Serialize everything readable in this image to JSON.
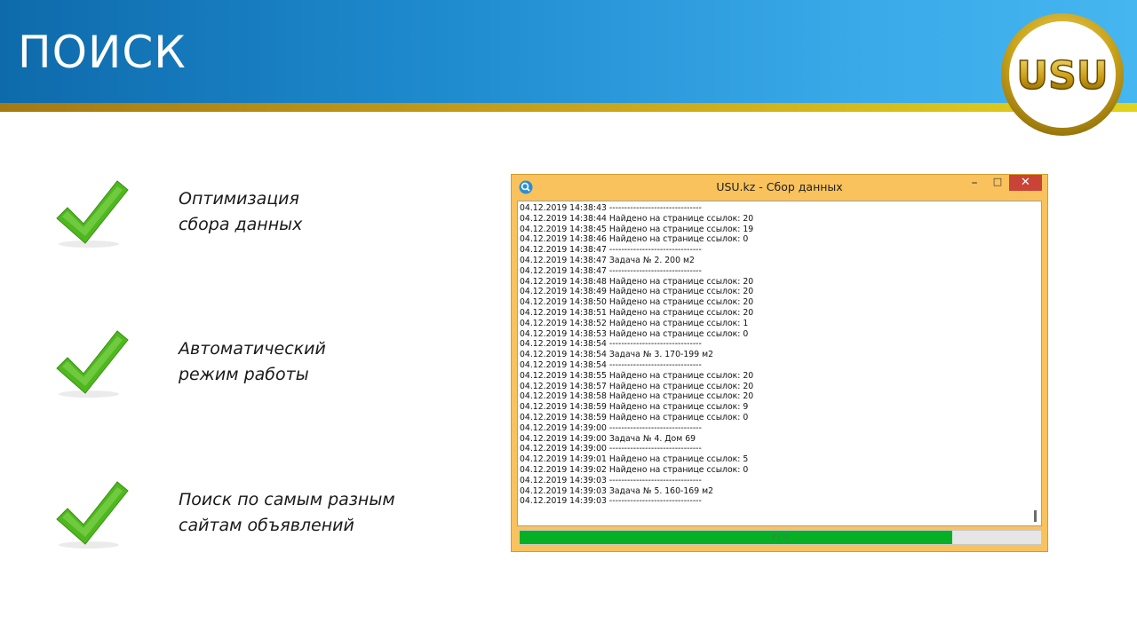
{
  "slide": {
    "title": "ПОИСК",
    "colors": {
      "header_start": "#0e6aab",
      "header_end": "#45b6f0",
      "gold": "#c9a21a",
      "check_green": "#4fb81f"
    }
  },
  "logo": {
    "text": "USU",
    "icon": "usu-logo"
  },
  "bullets": [
    {
      "line1": "Оптимизация",
      "line2": "сбора данных",
      "icon": "checkmark-icon"
    },
    {
      "line1": "Автоматический",
      "line2": "режим работы",
      "icon": "checkmark-icon"
    },
    {
      "line1": "Поиск по самым разным",
      "line2": "сайтам объявлений",
      "icon": "checkmark-icon"
    }
  ],
  "window": {
    "title": "USU.kz - Сбор данных",
    "icon": "search-app-icon",
    "controls": {
      "minimize": "–",
      "maximize": "□",
      "close": "✕"
    },
    "log_lines": [
      "04.12.2019 14:38:43 -------------------------------",
      "04.12.2019 14:38:44 Найдено на странице ссылок: 20",
      "04.12.2019 14:38:45 Найдено на странице ссылок: 19",
      "04.12.2019 14:38:46 Найдено на странице ссылок: 0",
      "04.12.2019 14:38:47 -------------------------------",
      "04.12.2019 14:38:47 Задача № 2. 200 м2",
      "04.12.2019 14:38:47 -------------------------------",
      "04.12.2019 14:38:48 Найдено на странице ссылок: 20",
      "04.12.2019 14:38:49 Найдено на странице ссылок: 20",
      "04.12.2019 14:38:50 Найдено на странице ссылок: 20",
      "04.12.2019 14:38:51 Найдено на странице ссылок: 20",
      "04.12.2019 14:38:52 Найдено на странице ссылок: 1",
      "04.12.2019 14:38:53 Найдено на странице ссылок: 0",
      "04.12.2019 14:38:54 -------------------------------",
      "04.12.2019 14:38:54 Задача № 3. 170-199 м2",
      "04.12.2019 14:38:54 -------------------------------",
      "04.12.2019 14:38:55 Найдено на странице ссылок: 20",
      "04.12.2019 14:38:57 Найдено на странице ссылок: 20",
      "04.12.2019 14:38:58 Найдено на странице ссылок: 20",
      "04.12.2019 14:38:59 Найдено на странице ссылок: 9",
      "04.12.2019 14:38:59 Найдено на странице ссылок: 0",
      "04.12.2019 14:39:00 -------------------------------",
      "04.12.2019 14:39:00 Задача № 4. Дом 69",
      "04.12.2019 14:39:00 -------------------------------",
      "04.12.2019 14:39:01 Найдено на странице ссылок: 5",
      "04.12.2019 14:39:02 Найдено на странице ссылок: 0",
      "04.12.2019 14:39:03 -------------------------------",
      "04.12.2019 14:39:03 Задача № 5. 160-169 м2",
      "04.12.2019 14:39:03 -------------------------------"
    ],
    "progress": {
      "percent": 83,
      "label": "83 %"
    }
  }
}
